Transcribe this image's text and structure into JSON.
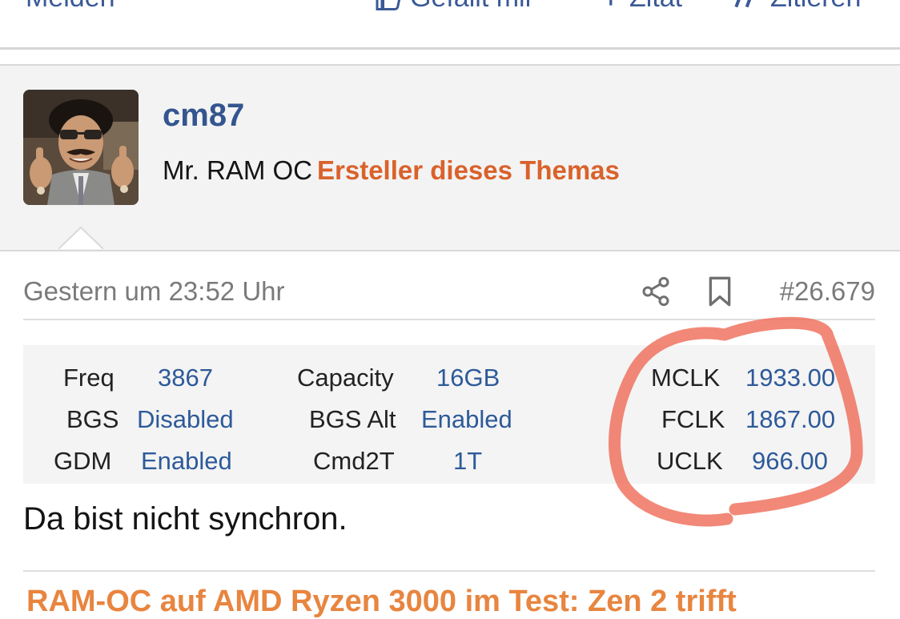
{
  "actions": {
    "report": "Melden",
    "like": "Gefällt mir",
    "quote": "Zitat",
    "reply": "Zitieren"
  },
  "user": {
    "name": "cm87",
    "title": "Mr. RAM OC",
    "op_badge": "Ersteller dieses Themas"
  },
  "post": {
    "date": "Gestern um 23:52 Uhr",
    "number": "#26.679",
    "body": "Da bist nicht synchron."
  },
  "signature": {
    "rows": [
      {
        "l1": "Freq",
        "v1": "3867",
        "l2": "Capacity",
        "v2": "16GB",
        "l3": "MCLK",
        "v3": "1933.00"
      },
      {
        "l1": "BGS",
        "v1": "Disabled",
        "l2": "BGS Alt",
        "v2": "Enabled",
        "l3": "FCLK",
        "v3": "1867.00"
      },
      {
        "l1": "GDM",
        "v1": "Enabled",
        "l2": "Cmd2T",
        "v2": "1T",
        "l3": "UCLK",
        "v3": "966.00"
      }
    ]
  },
  "link": {
    "title": "RAM-OC auf AMD Ryzen 3000 im Test: Zen 2 trifft"
  },
  "colors": {
    "link_blue": "#34558f",
    "value_blue": "#2d5a9a",
    "op_orange": "#d9622b",
    "article_orange": "#e8853f",
    "annotation_red": "#ef6e5a"
  },
  "icons": {
    "share": "share-icon",
    "bookmark": "bookmark-icon",
    "like": "thumbs-up-icon",
    "quote": "quote-icon"
  }
}
